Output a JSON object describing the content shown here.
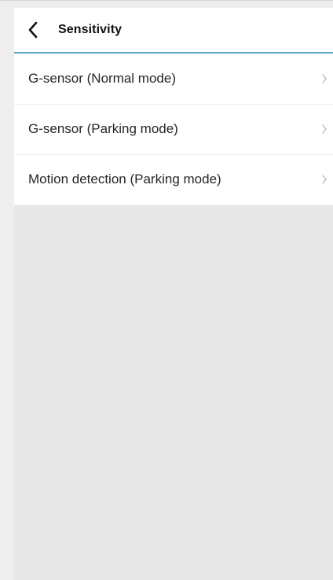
{
  "header": {
    "title": "Sensitivity",
    "back_icon": "chevron-left-icon"
  },
  "list": {
    "items": [
      {
        "label": "G-sensor (Normal mode)",
        "icon": "chevron-right-icon"
      },
      {
        "label": "G-sensor (Parking mode)",
        "icon": "chevron-right-icon"
      },
      {
        "label": "Motion detection (Parking mode)",
        "icon": "chevron-right-icon"
      }
    ]
  },
  "colors": {
    "accent_line": "#57a7c6",
    "background": "#e8e8e8",
    "surface": "#ffffff"
  }
}
